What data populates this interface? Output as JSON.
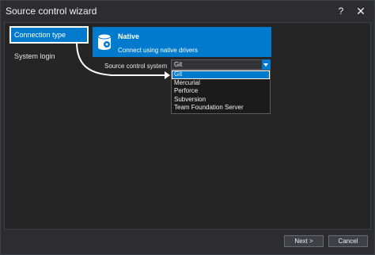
{
  "window": {
    "title": "Source control wizard"
  },
  "titlebar": {
    "help": "?",
    "close": "✕"
  },
  "nav": {
    "items": [
      {
        "label": "Connection type",
        "active": true
      },
      {
        "label": "System login",
        "active": false
      }
    ]
  },
  "banner": {
    "title": "Native",
    "subtitle": "Connect using native drivers",
    "icon": "database-icon"
  },
  "form": {
    "label": "Source control system",
    "selected": "Git",
    "options": [
      "Git",
      "Mercurial",
      "Perforce",
      "Subversion",
      "Team Foundation Server"
    ]
  },
  "footer": {
    "next": "Next >",
    "cancel": "Cancel"
  },
  "colors": {
    "accent": "#007acc",
    "background": "#252526",
    "frame": "#2d2d30"
  }
}
